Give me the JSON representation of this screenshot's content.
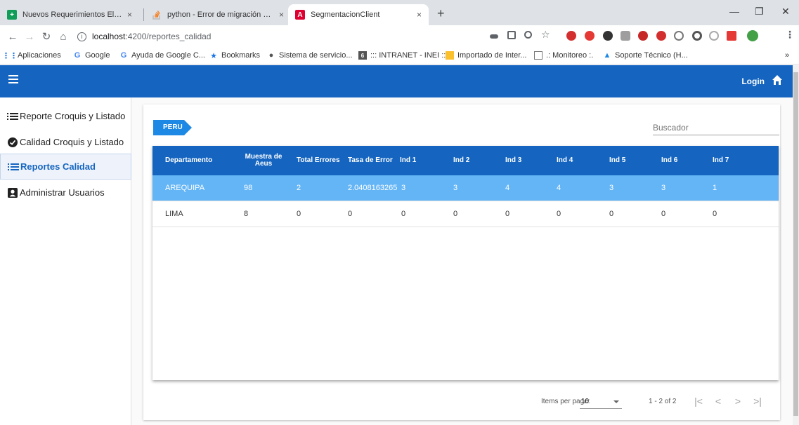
{
  "browser": {
    "tabs": [
      {
        "title": "Nuevos Requerimientos Elegajo -",
        "icon": "sheets-icon",
        "color": "#0f9d58"
      },
      {
        "title": "python - Error de migración de D",
        "icon": "stackoverflow-icon",
        "color": "#f48024"
      },
      {
        "title": "SegmentacionClient",
        "icon": "angular-icon",
        "color": "#dd0031"
      }
    ],
    "tab_close": "×",
    "new_tab": "+",
    "url_host": "localhost",
    "url_path": ":4200/reportes_calidad",
    "bookmarks": [
      {
        "label": "Aplicaciones",
        "icon": "apps-grid-icon"
      },
      {
        "label": "Google",
        "icon": "google-icon"
      },
      {
        "label": "Ayuda de Google C...",
        "icon": "google-icon"
      },
      {
        "label": "Bookmarks",
        "icon": "star-icon"
      },
      {
        "label": "Sistema de servicio...",
        "icon": "globe-icon"
      },
      {
        "label": "::: INTRANET - INEI :::",
        "icon": "inei-icon"
      },
      {
        "label": "Importado de Inter...",
        "icon": "folder-icon"
      },
      {
        "label": ".: Monitoreo :.",
        "icon": "monitor-icon"
      },
      {
        "label": "Soporte Técnico (H...",
        "icon": "support-icon"
      }
    ],
    "more_bookmarks": "»"
  },
  "app": {
    "login_label": "Login",
    "sidebar": [
      {
        "label": "Reporte Croquis y Listado",
        "icon": "list-icon",
        "active": false
      },
      {
        "label": "Calidad Croquis y Listado",
        "icon": "check-circle-icon",
        "active": false
      },
      {
        "label": "Reportes Calidad",
        "icon": "list-icon",
        "active": true
      },
      {
        "label": "Administrar Usuarios",
        "icon": "account-box-icon",
        "active": false
      }
    ],
    "breadcrumb": "PERU",
    "search_placeholder": "Buscador",
    "table": {
      "headers": [
        "Departamento",
        "Muestra de Aeus",
        "Total Errores",
        "Tasa de Error",
        "Ind 1",
        "Ind 2",
        "Ind 3",
        "Ind 4",
        "Ind 5",
        "Ind 6",
        "Ind 7"
      ],
      "rows": [
        [
          "AREQUIPA",
          "98",
          "2",
          "2.0408163265",
          "3",
          "3",
          "4",
          "4",
          "3",
          "3",
          "1"
        ],
        [
          "LIMA",
          "8",
          "0",
          "0",
          "0",
          "0",
          "0",
          "0",
          "0",
          "0",
          "0"
        ]
      ],
      "selected_row": 0
    },
    "paginator": {
      "items_per_page_label": "Items per page:",
      "page_size": "10",
      "range_label": "1 - 2 of 2",
      "first": "|<",
      "prev": "<",
      "next": ">",
      "last": ">|"
    },
    "colors": {
      "primary": "#1565c0",
      "selected_row": "#64b5f6",
      "breadcrumb": "#1e88e5"
    }
  }
}
